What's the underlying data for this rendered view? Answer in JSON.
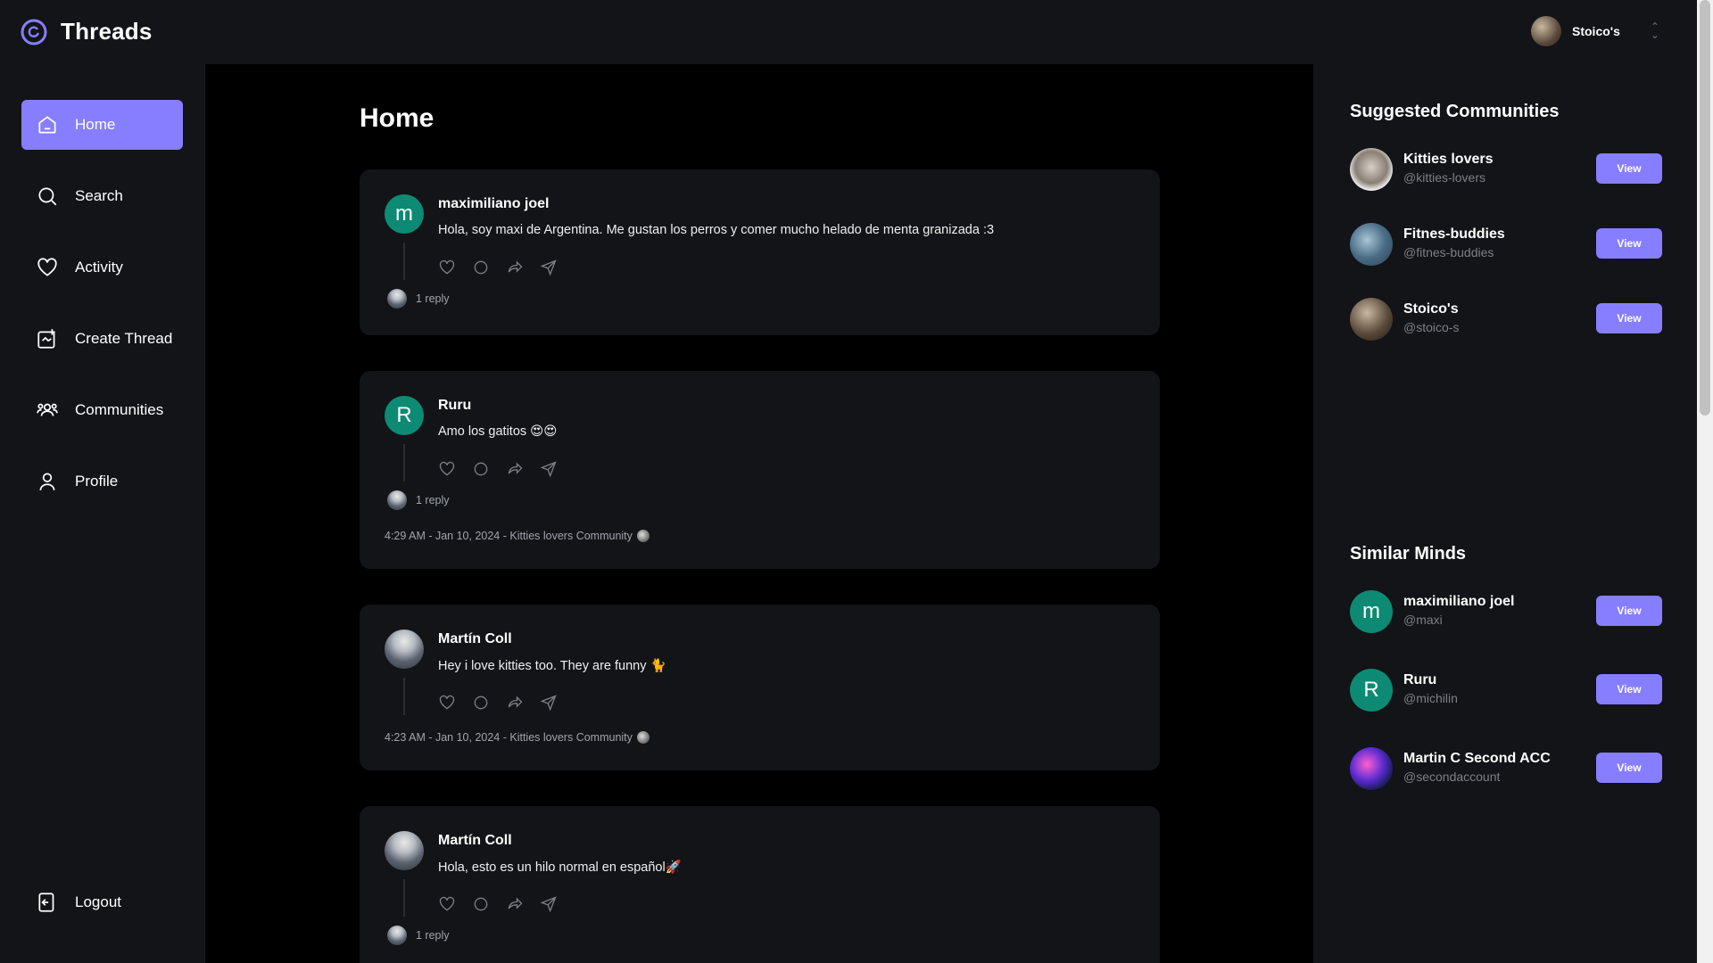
{
  "app": {
    "title": "Threads"
  },
  "org": {
    "name": "Stoico's"
  },
  "nav": {
    "items": [
      {
        "label": "Home",
        "icon": "home-icon",
        "active": true
      },
      {
        "label": "Search",
        "icon": "search-icon"
      },
      {
        "label": "Activity",
        "icon": "heart-icon"
      },
      {
        "label": "Create Thread",
        "icon": "create-thread-icon"
      },
      {
        "label": "Communities",
        "icon": "communities-icon"
      },
      {
        "label": "Profile",
        "icon": "user-icon"
      }
    ],
    "logout": "Logout"
  },
  "main": {
    "title": "Home",
    "threads": [
      {
        "author": "maximiliano joel",
        "avatar_letter": "m",
        "text": "Hola, soy maxi de Argentina. Me gustan los perros y comer mucho helado de menta granizada :3",
        "replies": "1 reply",
        "meta": ""
      },
      {
        "author": "Ruru",
        "avatar_letter": "R",
        "text": "Amo los gatitos 😍😍",
        "replies": "1 reply",
        "meta": "4:29 AM - Jan 10, 2024 - Kitties lovers Community"
      },
      {
        "author": "Martín Coll",
        "avatar_letter": "",
        "text": "Hey i love kitties too. They are funny 🐈",
        "replies": "",
        "meta": "4:23 AM - Jan 10, 2024 - Kitties lovers Community"
      },
      {
        "author": "Martín Coll",
        "avatar_letter": "",
        "text": "Hola, esto es un hilo normal en español🚀",
        "replies": "1 reply",
        "meta": ""
      }
    ]
  },
  "right": {
    "suggested_title": "Suggested Communities",
    "communities": [
      {
        "name": "Kitties lovers",
        "handle": "@kitties-lovers",
        "button": "View"
      },
      {
        "name": "Fitnes-buddies",
        "handle": "@fitnes-buddies",
        "button": "View"
      },
      {
        "name": "Stoico's",
        "handle": "@stoico-s",
        "button": "View"
      }
    ],
    "similar_title": "Similar Minds",
    "users": [
      {
        "name": "maximiliano joel",
        "handle": "@maxi",
        "letter": "m",
        "button": "View"
      },
      {
        "name": "Ruru",
        "handle": "@michilin",
        "letter": "R",
        "button": "View"
      },
      {
        "name": "Martin C Second ACC",
        "handle": "@secondaccount",
        "letter": "",
        "button": "View"
      }
    ]
  },
  "colors": {
    "accent": "#877eff",
    "panel": "#121417",
    "avatar_teal": "#0d8a73"
  }
}
